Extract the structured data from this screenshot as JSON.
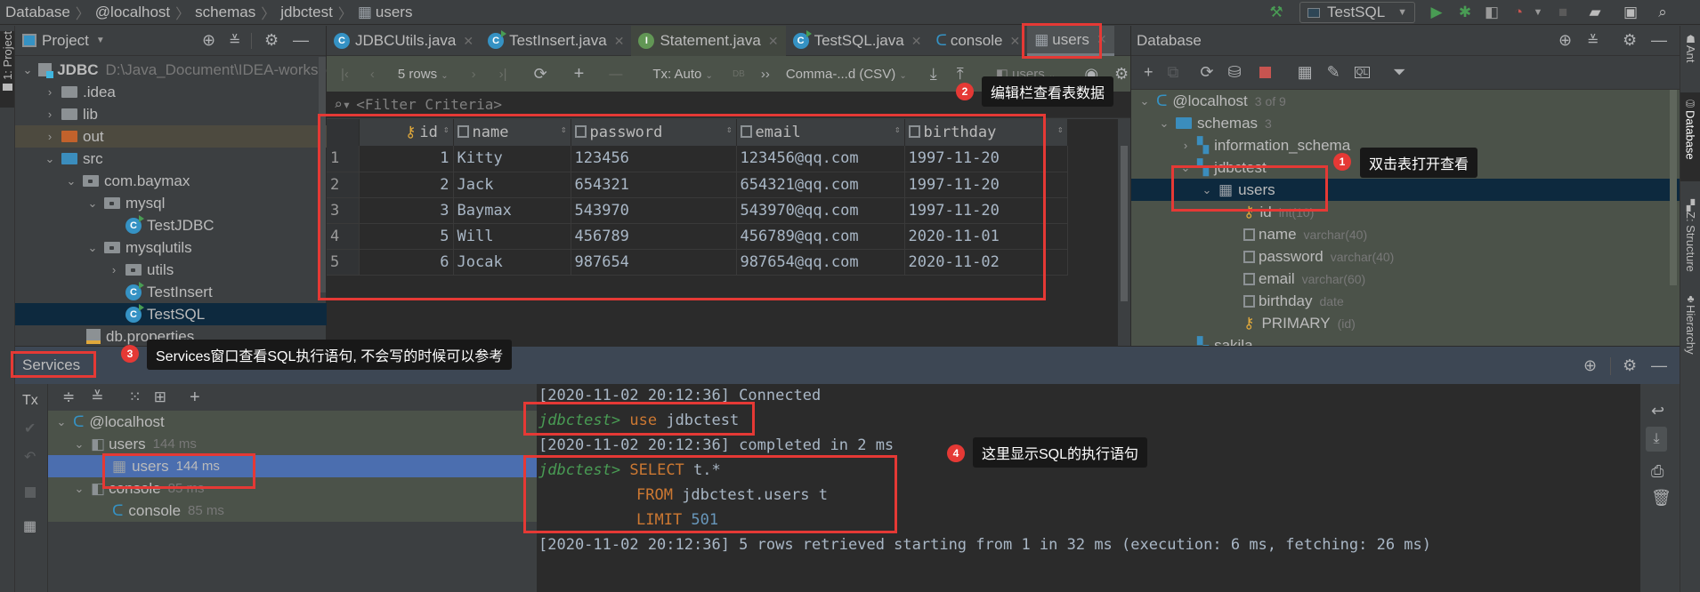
{
  "breadcrumb": [
    "Database",
    "@localhost",
    "schemas",
    "jdbctest",
    "users"
  ],
  "run_config": {
    "name": "TestSQL"
  },
  "left_stripe": {
    "project_label": "1: Project"
  },
  "project": {
    "title": "Project",
    "root": {
      "name": "JDBC",
      "path": "D:\\Java_Document\\IDEA-worksp"
    },
    "items": [
      {
        "label": ".idea",
        "type": "folder",
        "depth": 1,
        "state": "collapsed"
      },
      {
        "label": "lib",
        "type": "folder",
        "depth": 1,
        "state": "collapsed"
      },
      {
        "label": "out",
        "type": "folder-excluded",
        "depth": 1,
        "state": "collapsed"
      },
      {
        "label": "src",
        "type": "folder-source",
        "depth": 1,
        "state": "expanded"
      },
      {
        "label": "com.baymax",
        "type": "package",
        "depth": 2,
        "state": "expanded"
      },
      {
        "label": "mysql",
        "type": "package",
        "depth": 3,
        "state": "expanded"
      },
      {
        "label": "TestJDBC",
        "type": "class",
        "depth": 4
      },
      {
        "label": "mysqlutils",
        "type": "package",
        "depth": 3,
        "state": "expanded"
      },
      {
        "label": "utils",
        "type": "package",
        "depth": 4,
        "state": "collapsed"
      },
      {
        "label": "TestInsert",
        "type": "class",
        "depth": 4
      },
      {
        "label": "TestSQL",
        "type": "class",
        "depth": 4,
        "selected": true
      },
      {
        "label": "db.properties",
        "type": "properties",
        "depth": 2
      }
    ]
  },
  "editor_tabs": [
    {
      "label": "JDBCUtils.java",
      "icon": "class-icon"
    },
    {
      "label": "TestInsert.java",
      "icon": "class-run-icon"
    },
    {
      "label": "Statement.java",
      "icon": "interface-icon"
    },
    {
      "label": "TestSQL.java",
      "icon": "class-icon"
    },
    {
      "label": "console",
      "icon": "mysql-dolphin-icon"
    },
    {
      "label": "users",
      "icon": "table-icon",
      "active": true
    }
  ],
  "data_toolbar": {
    "rows": "5 rows",
    "tx": "Tx: Auto",
    "export_format": "Comma-...d (CSV)",
    "datasource": "users"
  },
  "filter": {
    "placeholder": "<Filter Criteria>"
  },
  "grid": {
    "columns": [
      "id",
      "name",
      "password",
      "email",
      "birthday"
    ],
    "rows": [
      {
        "n": "1",
        "id": "1",
        "name": "Kitty",
        "password": "123456",
        "email": "123456@qq.com",
        "birthday": "1997-11-20"
      },
      {
        "n": "2",
        "id": "2",
        "name": "Jack",
        "password": "654321",
        "email": "654321@qq.com",
        "birthday": "1997-11-20"
      },
      {
        "n": "3",
        "id": "3",
        "name": "Baymax",
        "password": "543970",
        "email": "543970@qq.com",
        "birthday": "1997-11-20"
      },
      {
        "n": "4",
        "id": "5",
        "name": "Will",
        "password": "456789",
        "email": "456789@qq.com",
        "birthday": "2020-11-01"
      },
      {
        "n": "5",
        "id": "6",
        "name": "Jocak",
        "password": "987654",
        "email": "987654@qq.com",
        "birthday": "2020-11-02"
      }
    ]
  },
  "database": {
    "title": "Database",
    "host": {
      "label": "@localhost",
      "count": "3 of 9"
    },
    "schemas": {
      "label": "schemas",
      "count": "3"
    },
    "items": [
      {
        "label": "information_schema",
        "type": "schema"
      },
      {
        "label": "jdbctest",
        "type": "schema"
      },
      {
        "label": "users",
        "type": "table",
        "selected": true
      },
      {
        "label": "id",
        "type": "column-key",
        "detail": "int(10)"
      },
      {
        "label": "name",
        "type": "column",
        "detail": "varchar(40)"
      },
      {
        "label": "password",
        "type": "column",
        "detail": "varchar(40)"
      },
      {
        "label": "email",
        "type": "column",
        "detail": "varchar(60)"
      },
      {
        "label": "birthday",
        "type": "column",
        "detail": "date"
      },
      {
        "label": "PRIMARY",
        "type": "index",
        "detail": "(id)"
      },
      {
        "label": "sakila",
        "type": "schema"
      }
    ]
  },
  "right_stripe": [
    "Ant",
    "Database",
    "Z: Structure",
    "Hierarchy"
  ],
  "services": {
    "title": "Services",
    "tx_label": "Tx",
    "tree": [
      {
        "label": "@localhost",
        "detail": ""
      },
      {
        "label": "users",
        "detail": "144 ms"
      },
      {
        "label": "users",
        "detail": "144 ms",
        "selected": true
      },
      {
        "label": "console",
        "detail": "85 ms"
      },
      {
        "label": "console",
        "detail": "85 ms"
      }
    ]
  },
  "console": {
    "lines": [
      {
        "kind": "log",
        "text": "[2020-11-02 20:12:36] Connected"
      },
      {
        "kind": "cmd",
        "prompt": "jdbctest>",
        "kw": "use",
        "rest": " jdbctest"
      },
      {
        "kind": "log",
        "text": "[2020-11-02 20:12:36] completed in 2 ms"
      },
      {
        "kind": "cmd",
        "prompt": "jdbctest>",
        "kw": "SELECT",
        "rest": " t.*"
      },
      {
        "kind": "cont",
        "kw": "FROM",
        "rest": " jdbctest.users t"
      },
      {
        "kind": "cont",
        "kw": "LIMIT",
        "num": " 501"
      },
      {
        "kind": "log",
        "text": "[2020-11-02 20:12:36] 5 rows retrieved starting from 1 in 32 ms (execution: 6 ms, fetching: 26 ms)"
      }
    ]
  },
  "annotations": [
    {
      "num": "1",
      "text": "双击表打开查看"
    },
    {
      "num": "2",
      "text": "编辑栏查看表数据"
    },
    {
      "num": "3",
      "text": "Services窗口查看SQL执行语句, 不会写的时候可以参考"
    },
    {
      "num": "4",
      "text": "这里显示SQL的执行语句"
    }
  ],
  "colors": {
    "accent_red": "#e53935",
    "selection": "#0d293e",
    "service_selection": "#4b6eaf",
    "prompt_green": "#499c54",
    "keyword_orange": "#cc7832"
  }
}
